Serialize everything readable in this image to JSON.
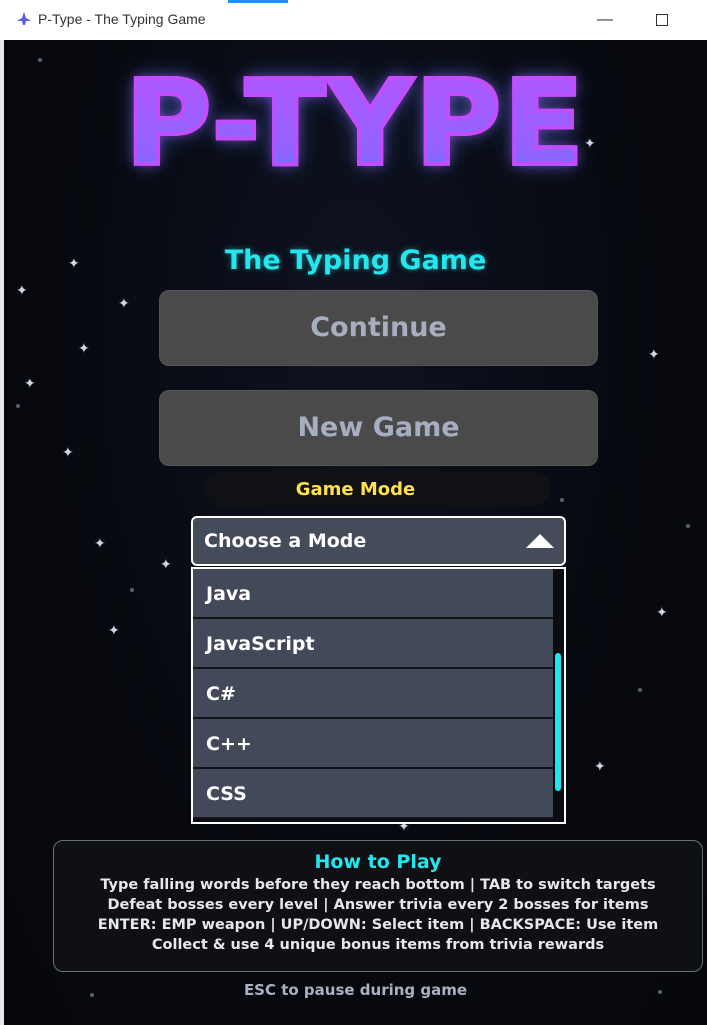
{
  "window": {
    "title": "P-Type - The Typing Game",
    "minimize": "—"
  },
  "game": {
    "logo": "P-TYPE",
    "subtitle": "The Typing Game",
    "continue_label": "Continue",
    "new_game_label": "New Game",
    "mode_label": "Game Mode",
    "mode_select": {
      "selected": "Choose a Mode",
      "options": [
        "Java",
        "JavaScript",
        "C#",
        "C++",
        "CSS"
      ]
    },
    "howto": {
      "title": "How to Play",
      "lines": [
        "Type falling words before they reach bottom | TAB to switch targets",
        "Defeat bosses every level | Answer trivia every 2 bosses for items",
        "ENTER: EMP weapon | UP/DOWN: Select item | BACKSPACE: Use item",
        "Collect & use 4 unique bonus items from trivia rewards"
      ]
    },
    "esc_hint": "ESC to pause during game"
  },
  "colors": {
    "accent_cyan": "#22e7ef",
    "mode_yellow": "#ffe14a",
    "logo_magenta": "#c14dff",
    "logo_blue": "#2f8dff",
    "button_bg": "#4a4a4a",
    "option_bg": "#424958"
  },
  "icons": {
    "app": "spaceship-icon",
    "maximize": "maximize-icon",
    "caret": "caret-up-icon"
  }
}
